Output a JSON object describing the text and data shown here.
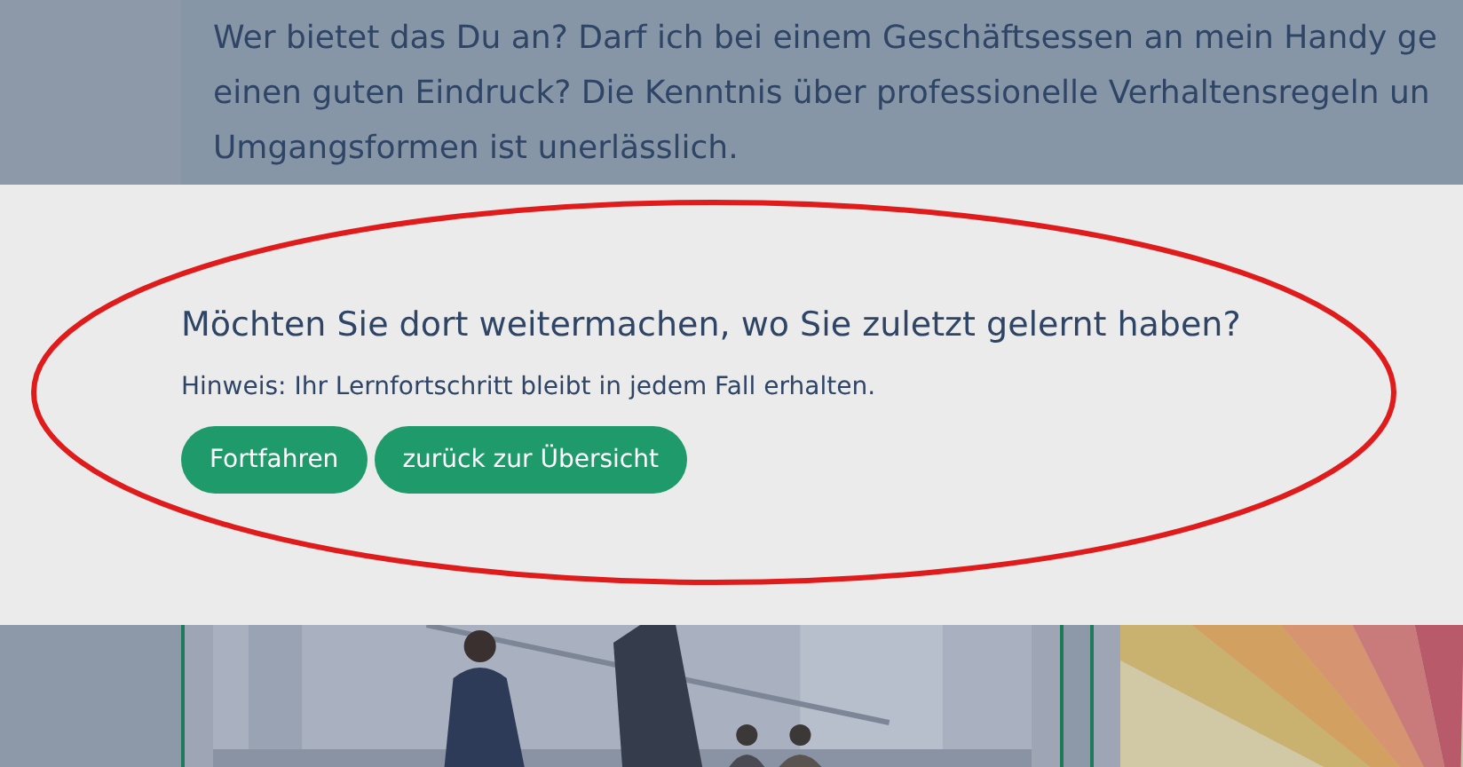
{
  "intro_text": "Wer bietet das Du an? Darf ich bei einem Geschäftsessen an mein Handy ge\neinen guten Eindruck? Die Kenntnis über professionelle Verhaltensregeln un\nUmgangsformen ist unerlässlich.",
  "dialog": {
    "heading": "Möchten Sie dort weitermachen, wo Sie zuletzt gelernt haben?",
    "hint": "Hinweis: Ihr Lernfortschritt bleibt in jedem Fall erhalten.",
    "buttons": [
      "Fortfahren",
      "zurück zur Übersicht"
    ]
  }
}
